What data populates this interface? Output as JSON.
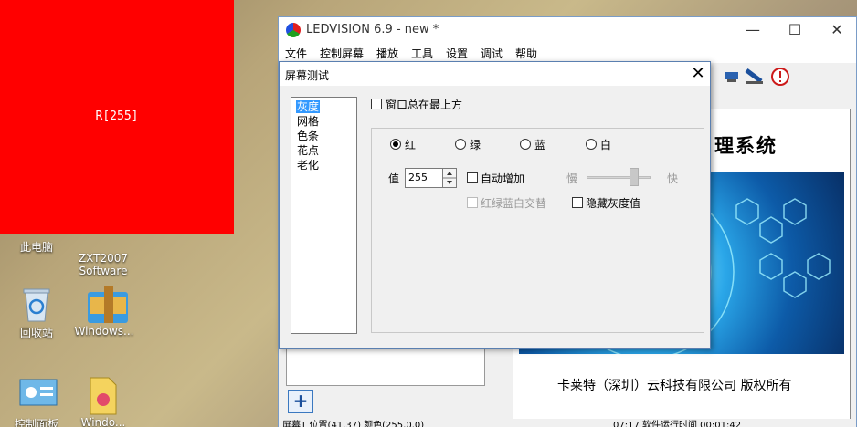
{
  "red_window": {
    "label": "R[255]"
  },
  "desktop": {
    "icons": [
      {
        "name": "this-pc-icon",
        "label": "此电脑"
      },
      {
        "name": "zxt-software-icon",
        "label": "ZXT2007\nSoftware"
      },
      {
        "name": "recycle-bin-icon",
        "label": "回收站"
      },
      {
        "name": "windows-folder-icon",
        "label": "Windows..."
      },
      {
        "name": "control-panel-icon",
        "label": "控制面板"
      },
      {
        "name": "windows-file-icon",
        "label": "Windo..."
      }
    ]
  },
  "app": {
    "title": "LEDVISION 6.9 - new *",
    "window_buttons": {
      "minimize": "—",
      "maximize": "☐",
      "close": "✕"
    },
    "menu": [
      "文件",
      "控制屏幕",
      "播放",
      "工具",
      "设置",
      "调试",
      "帮助"
    ],
    "logo_title": "理系统",
    "copyright": "卡莱特（深圳）云科技有限公司  版权所有",
    "add_button": "+",
    "status_left": "屏幕1 位置(41,37) 颜色(255,0,0)",
    "status_right": "07:17 软件运行时间 00:01:42"
  },
  "dialog": {
    "title": "屏幕测试",
    "close": "✕",
    "test_modes": [
      "灰度",
      "网格",
      "色条",
      "花点",
      "老化"
    ],
    "selected_mode": "灰度",
    "always_on_top_label": "窗口总在最上方",
    "colors": [
      {
        "label": "红",
        "checked": true
      },
      {
        "label": "绿",
        "checked": false
      },
      {
        "label": "蓝",
        "checked": false
      },
      {
        "label": "白",
        "checked": false
      }
    ],
    "value_label": "值",
    "value": "255",
    "auto_increase_label": "自动增加",
    "slow_label": "慢",
    "fast_label": "快",
    "rgbw_alternate_label": "红绿蓝白交替",
    "hide_gray_label": "隐藏灰度值"
  },
  "colors": {
    "red_window": "#ff0000",
    "selection": "#3399ff",
    "accent_border": "#5a7fb0"
  }
}
